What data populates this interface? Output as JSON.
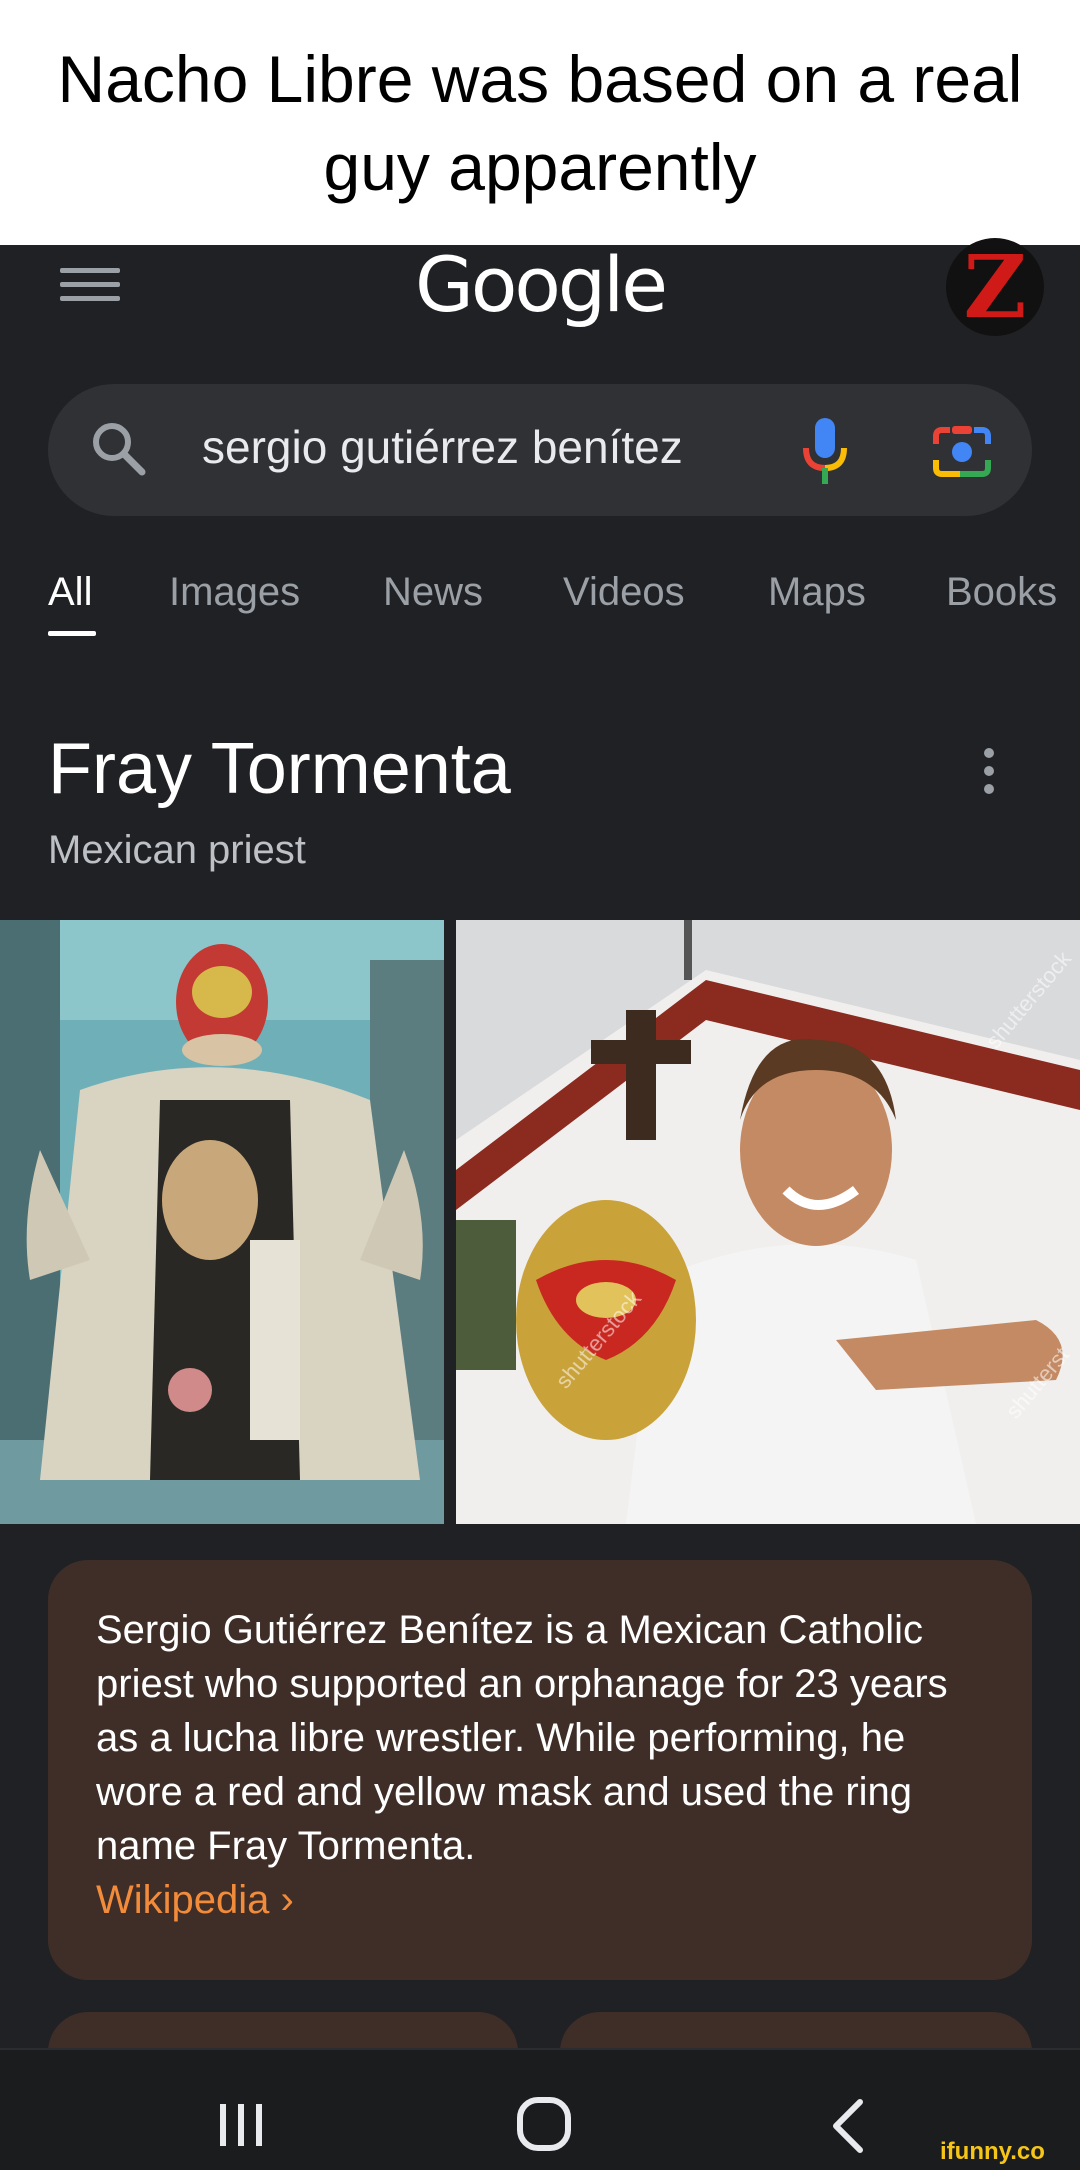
{
  "caption": "Nacho Libre was based on a real guy apparently",
  "header": {
    "logo": "Google",
    "avatar_letter": "Z"
  },
  "search": {
    "query": "sergio gutiérrez benítez"
  },
  "tabs": [
    {
      "label": "All",
      "active": true
    },
    {
      "label": "Images"
    },
    {
      "label": "News"
    },
    {
      "label": "Videos"
    },
    {
      "label": "Maps"
    },
    {
      "label": "Books"
    }
  ],
  "entity": {
    "title": "Fray Tormenta",
    "subtitle": "Mexican priest"
  },
  "images": {
    "img2_watermarks": [
      "shutterstock",
      "shutterstock",
      "shutterst"
    ]
  },
  "description": {
    "text": "Sergio Gutiérrez Benítez is a Mexican Catholic priest who supported an orphanage for 23 years as a lucha libre wrestler. While performing, he wore a red and yellow mask and used the ring name Fray Tormenta.",
    "link": "Wikipedia ›"
  },
  "watermark": "ifunny.co",
  "colors": {
    "background": "#202124",
    "card": "#3f2e27",
    "link": "#f28b3a",
    "text": "#e8eaed"
  },
  "icons": [
    "hamburger-menu-icon",
    "search-icon",
    "microphone-icon",
    "google-lens-icon",
    "more-vert-icon",
    "recents-icon",
    "home-icon",
    "back-icon"
  ]
}
